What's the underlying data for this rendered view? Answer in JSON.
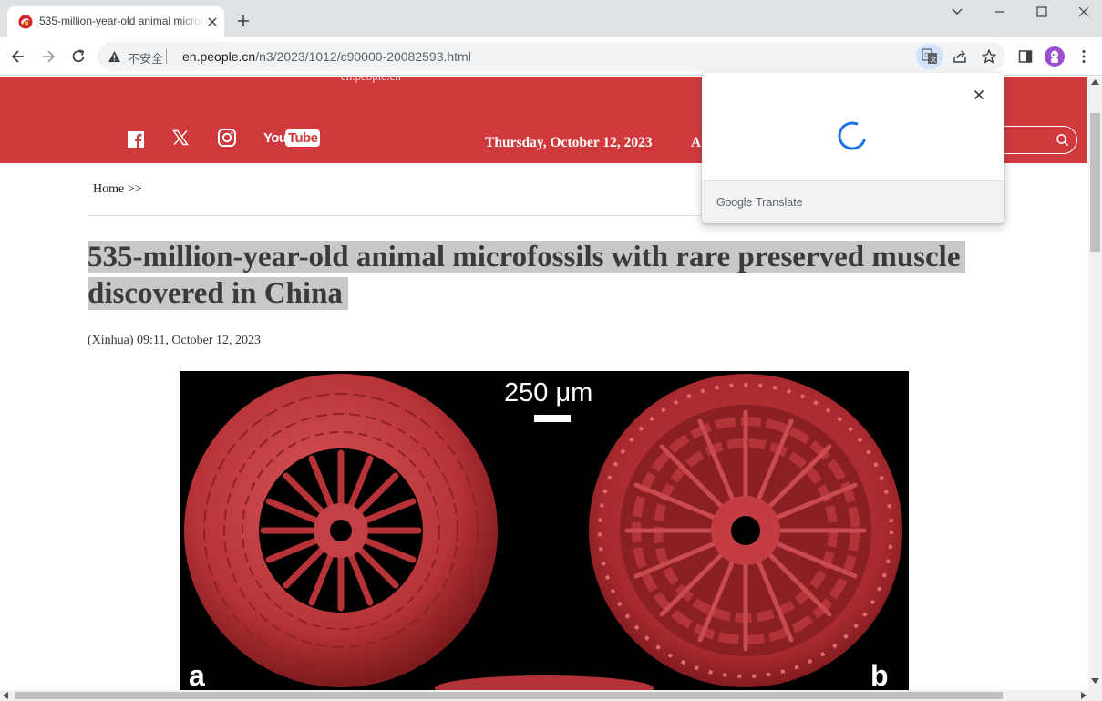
{
  "browser": {
    "tab_title": "535-million-year-old animal microfossils with rare preserved muscle discovered in China",
    "omnibox": {
      "security_label": "不安全",
      "url_host": "en.people.cn",
      "url_path": "/n3/2023/1012/c90000-20082593.html"
    },
    "icons": [
      "back-icon",
      "forward-icon",
      "reload-icon",
      "warning-icon",
      "translate-icon",
      "share-icon",
      "star-icon",
      "side-panel-icon",
      "profile-avatar",
      "kebab-menu-icon"
    ]
  },
  "site": {
    "brand_color": "#d03a3d",
    "header_cut_text": "en.people.cn",
    "social": [
      "facebook",
      "x",
      "instagram",
      "youtube"
    ],
    "youtube_label_you": "You",
    "youtube_label_tube": "Tube",
    "date": "Thursday, October 12, 2023",
    "header_partial_text": "A"
  },
  "article": {
    "breadcrumb": "Home >>",
    "title": "535-million-year-old animal microfossils with rare preserved muscle discovered in China",
    "byline": "(Xinhua) 09:11, October 12, 2023",
    "photo": {
      "scale_label": "250 μm",
      "panel_a": "a",
      "panel_b": "b"
    }
  },
  "translate_popup": {
    "brand_google": "Google",
    "brand_translate": "Translate",
    "state": "loading"
  }
}
